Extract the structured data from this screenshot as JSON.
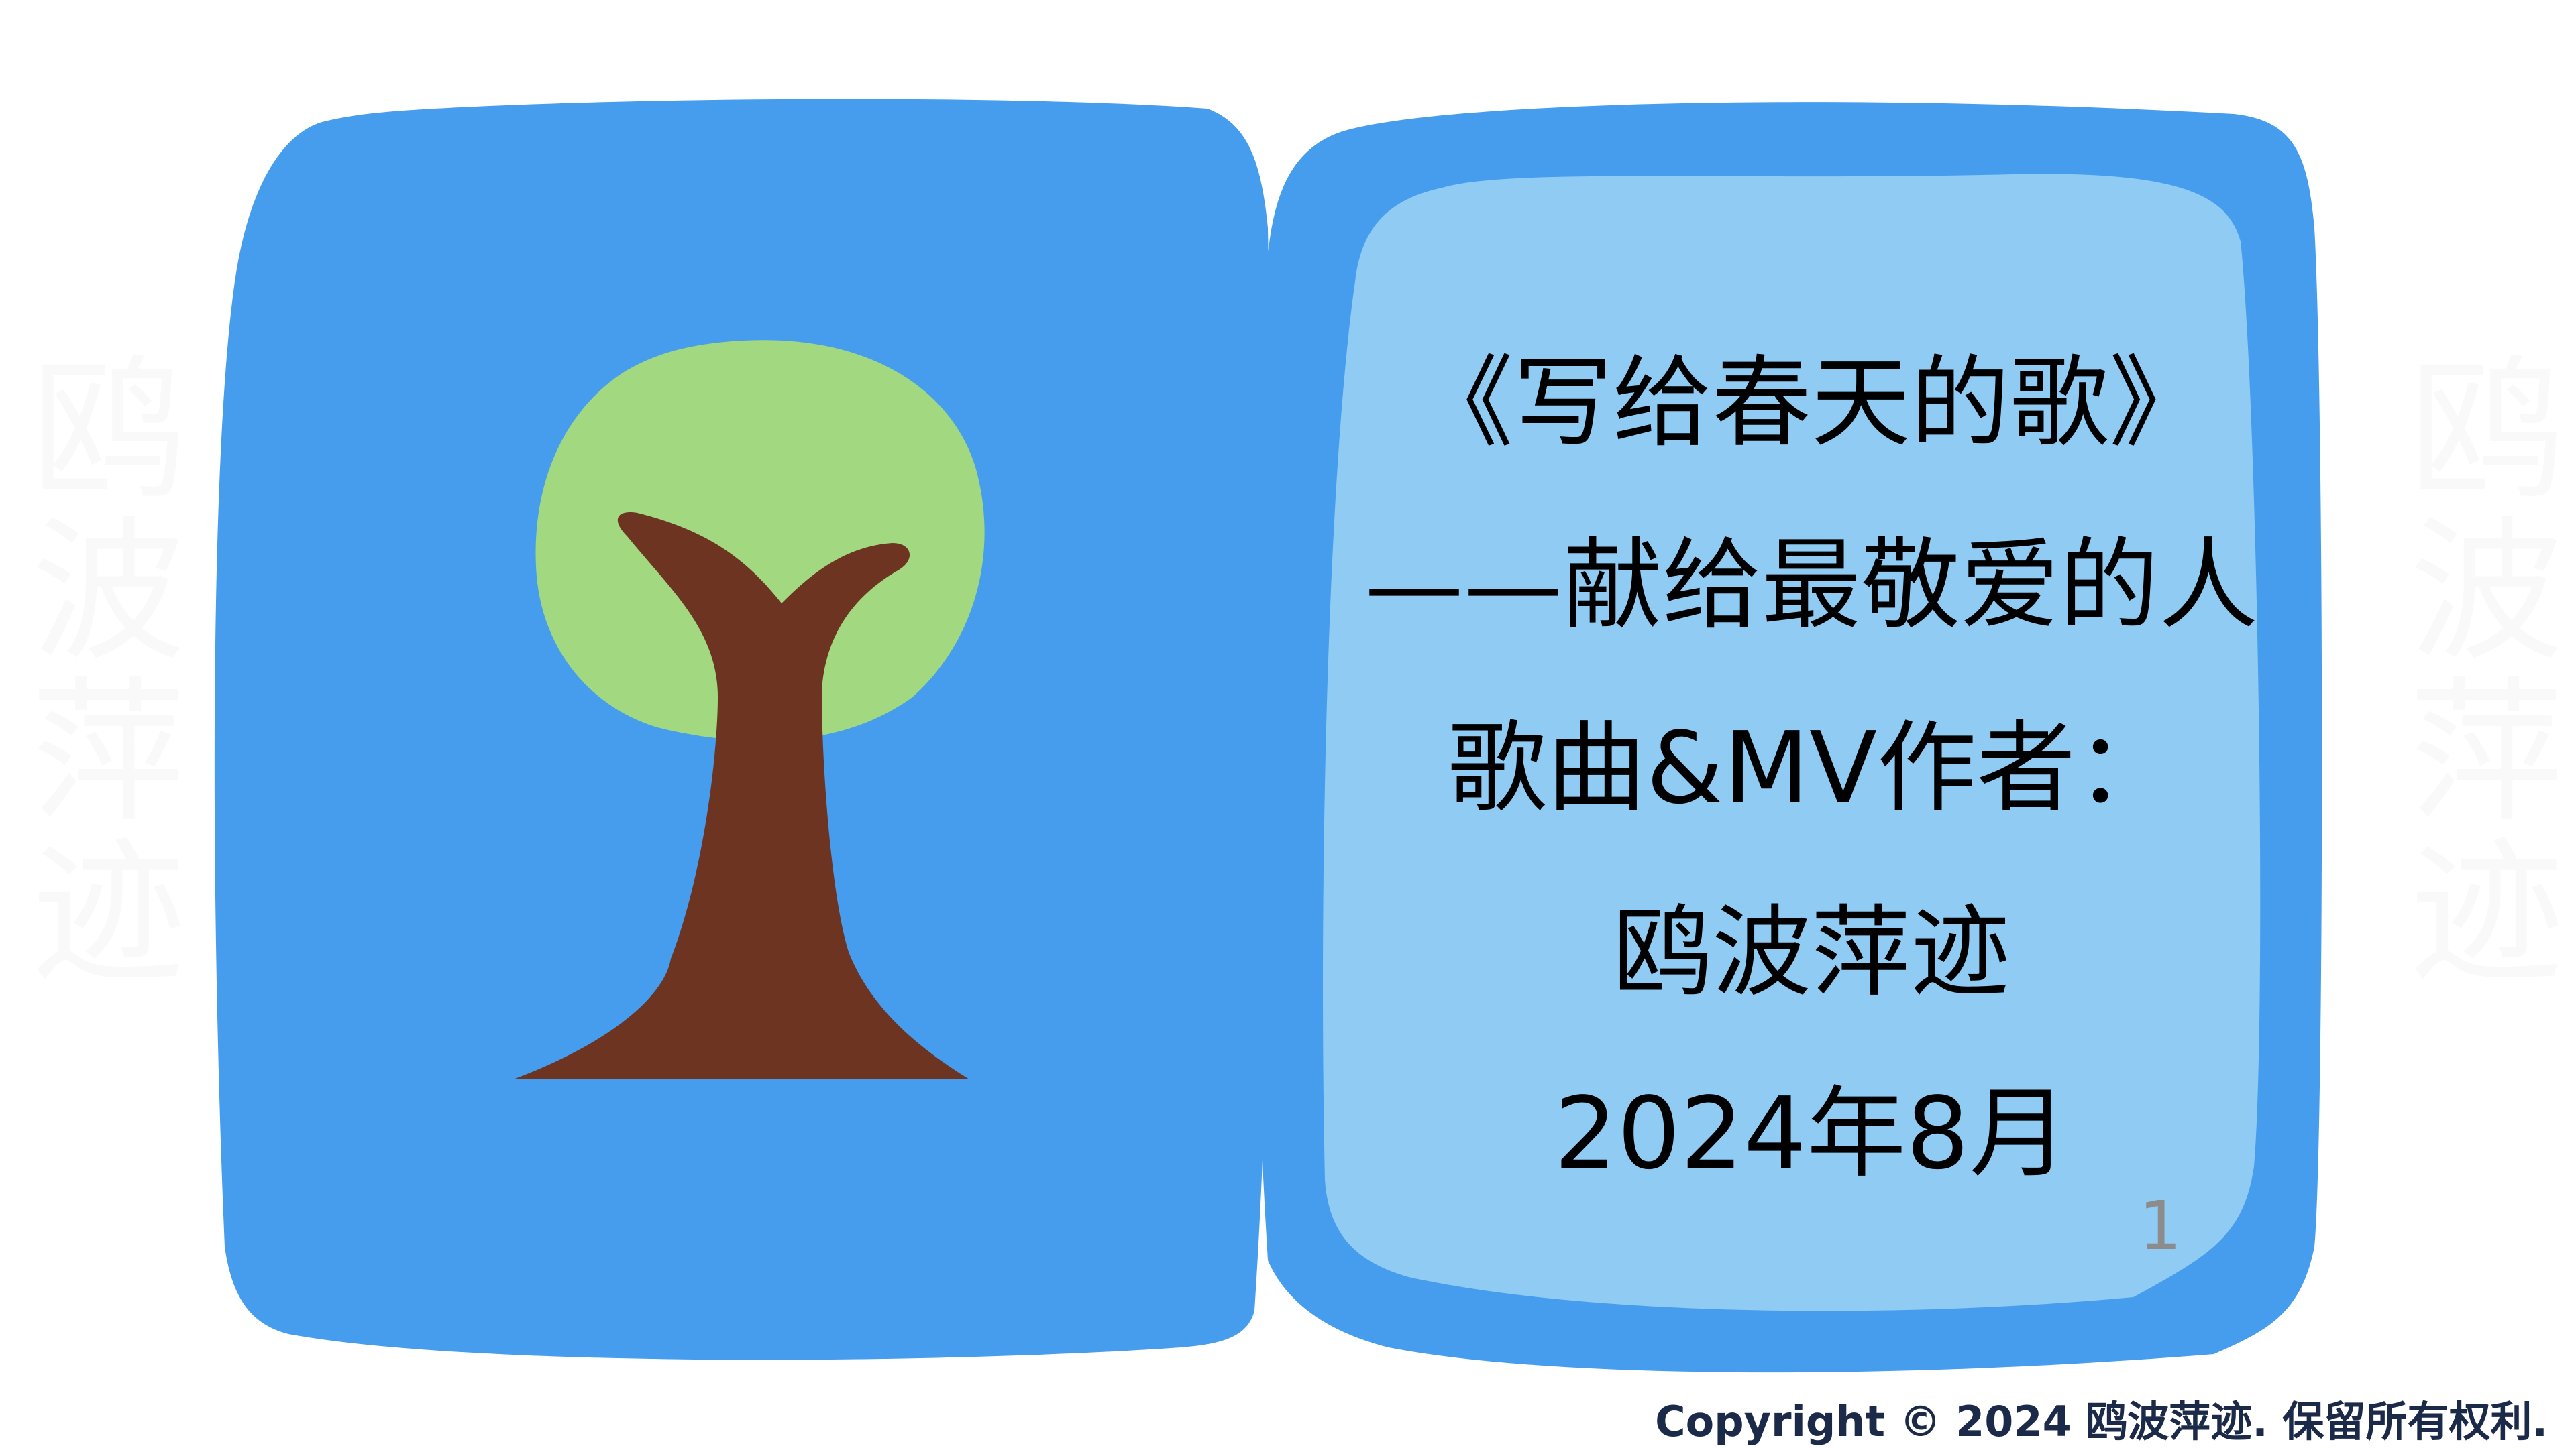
{
  "cover": {
    "title": "《写给春天的歌》",
    "subtitle": "——献给最敬爱的人",
    "role": "歌曲&MV作者：",
    "author": "鸥波萍迹",
    "date": "2024年8月"
  },
  "page_number": "1",
  "copyright": "Copyright © 2024 鸥波萍迹. 保留所有权利.",
  "watermark": {
    "left": "鸥波萍迹",
    "right": "鸥波萍迹"
  },
  "colors": {
    "book": "#469ded",
    "page": "#8fcbf2",
    "foliage": "#a2d980",
    "trunk": "#6d3422",
    "copyright": "#1c2a49"
  }
}
